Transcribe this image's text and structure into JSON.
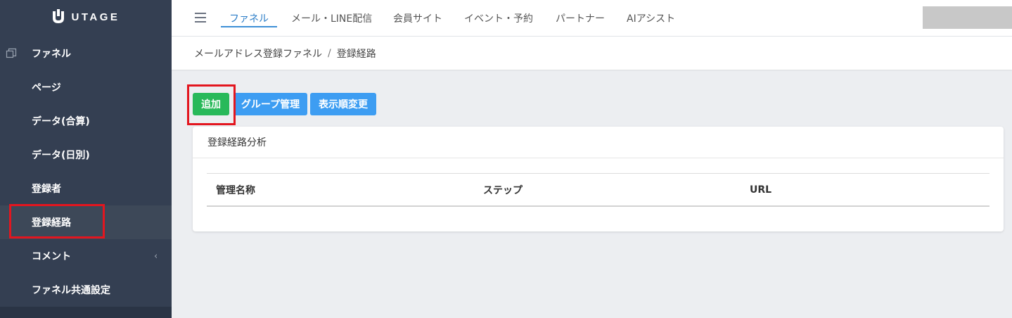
{
  "brand": {
    "name": "UTAGE"
  },
  "sidebar": {
    "items": [
      {
        "label": "ファネル"
      },
      {
        "label": "ページ"
      },
      {
        "label": "データ(合算)"
      },
      {
        "label": "データ(日別)"
      },
      {
        "label": "登録者"
      },
      {
        "label": "登録経路"
      },
      {
        "label": "コメント",
        "chevron": "‹"
      },
      {
        "label": "ファネル共通設定"
      }
    ]
  },
  "topnav": {
    "tabs": [
      {
        "label": "ファネル"
      },
      {
        "label": "メール・LINE配信"
      },
      {
        "label": "会員サイト"
      },
      {
        "label": "イベント・予約"
      },
      {
        "label": "パートナー"
      },
      {
        "label": "AIアシスト"
      }
    ],
    "active_tab": "ファネル"
  },
  "breadcrumb": {
    "items": [
      "メールアドレス登録ファネル",
      "登録経路"
    ],
    "separator": "/"
  },
  "toolbar": {
    "add_label": "追加",
    "group_label": "グループ管理",
    "order_label": "表示順変更"
  },
  "card": {
    "title": "登録経路分析",
    "columns": [
      "管理名称",
      "ステップ",
      "URL"
    ]
  },
  "colors": {
    "sidebar_bg": "#343f52",
    "accent": "#3d8fd6",
    "add_button": "#28b95a",
    "blue_button": "#3d9df2",
    "highlight": "#e3161f"
  }
}
